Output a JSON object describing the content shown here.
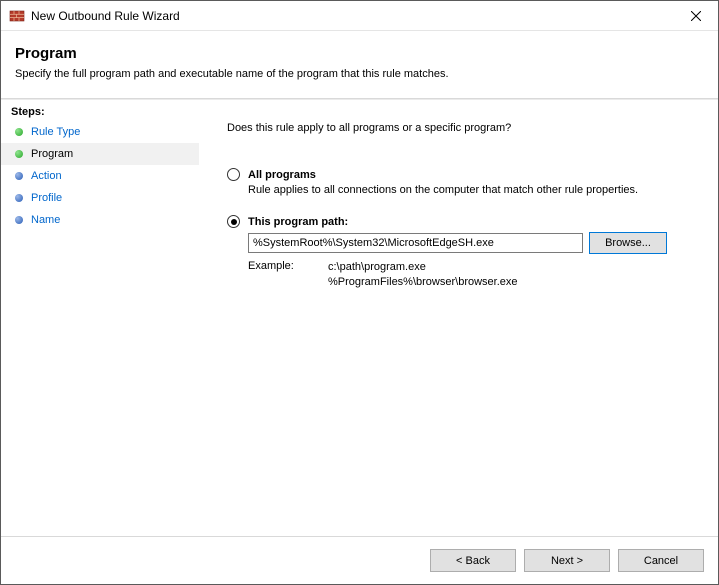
{
  "window": {
    "title": "New Outbound Rule Wizard"
  },
  "header": {
    "title": "Program",
    "subtitle": "Specify the full program path and executable name of the program that this rule matches."
  },
  "sidebar": {
    "heading": "Steps:",
    "items": [
      {
        "label": "Rule Type"
      },
      {
        "label": "Program"
      },
      {
        "label": "Action"
      },
      {
        "label": "Profile"
      },
      {
        "label": "Name"
      }
    ]
  },
  "content": {
    "question": "Does this rule apply to all programs or a specific program?",
    "option_all": {
      "label": "All programs",
      "desc": "Rule applies to all connections on the computer that match other rule properties."
    },
    "option_path": {
      "label": "This program path:",
      "value": "%SystemRoot%\\System32\\MicrosoftEdgeSH.exe",
      "browse": "Browse..."
    },
    "example": {
      "label": "Example:",
      "text": "c:\\path\\program.exe\n%ProgramFiles%\\browser\\browser.exe"
    }
  },
  "footer": {
    "back": "< Back",
    "next": "Next >",
    "cancel": "Cancel"
  }
}
